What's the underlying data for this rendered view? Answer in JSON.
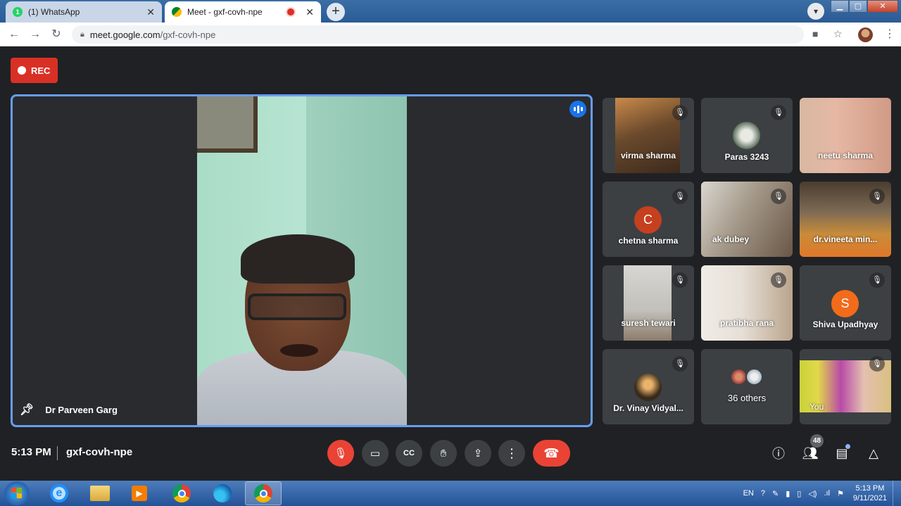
{
  "browser": {
    "tabs": [
      {
        "title": "(1) WhatsApp",
        "badge": "1",
        "close": "✕"
      },
      {
        "title": "Meet - gxf-covh-npe",
        "close": "✕"
      }
    ],
    "new_tab": "+",
    "url_host": "meet.google.com",
    "url_path": "/gxf-covh-npe",
    "window_buttons": {
      "minimize": "▁",
      "maximize": "▢",
      "close": "✕"
    }
  },
  "meet": {
    "rec_label": "REC",
    "presenter_name": "Dr Parveen Garg",
    "tiles": [
      {
        "name": "virma sharma",
        "type": "video"
      },
      {
        "name": "Paras 3243",
        "type": "avatar"
      },
      {
        "name": "neetu sharma",
        "type": "video"
      },
      {
        "name": "chetna sharma",
        "type": "initial",
        "initial": "C",
        "color": "#c5401e"
      },
      {
        "name": "ak dubey",
        "type": "video"
      },
      {
        "name": "dr.vineeta min...",
        "type": "video"
      },
      {
        "name": "suresh tewari",
        "type": "video"
      },
      {
        "name": "pratibha rana",
        "type": "video"
      },
      {
        "name": "Shiva Upadhyay",
        "type": "initial",
        "initial": "S",
        "color": "#f26b1a"
      },
      {
        "name": "Dr. Vinay Vidyal...",
        "type": "avatar"
      },
      {
        "name": "36 others",
        "type": "others"
      },
      {
        "name": "You",
        "type": "video"
      }
    ],
    "time": "5:13 PM",
    "meeting_code": "gxf-covh-npe",
    "participant_count": "48"
  },
  "taskbar": {
    "lang": "EN",
    "time": "5:13 PM",
    "date": "9/11/2021"
  },
  "colors": {
    "accent": "#669df6",
    "danger": "#ea4335",
    "bg": "#202124",
    "tile": "#3c4043"
  }
}
